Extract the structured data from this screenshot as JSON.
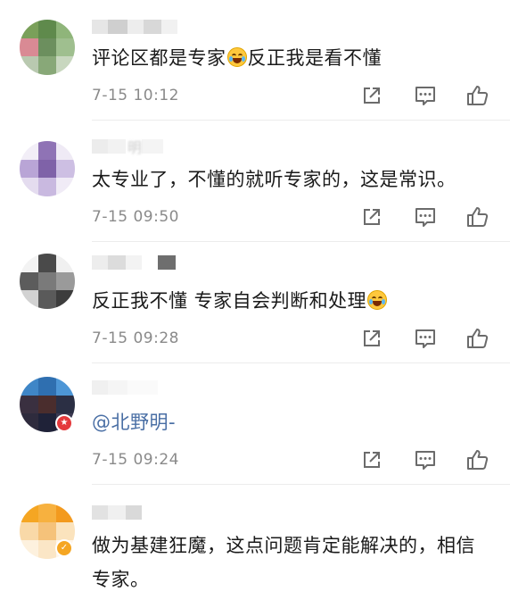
{
  "comments": [
    {
      "text_before": "评论区都是专家",
      "text_after": "反正我是看不懂",
      "time": "7-15 10:12"
    },
    {
      "username_visible": "明",
      "text": "太专业了，不懂的就听专家的，这是常识。",
      "time": "7-15 09:50"
    },
    {
      "text": "反正我不懂 专家自会判断和处理",
      "time": "7-15 09:28"
    },
    {
      "text": "@北野明-",
      "time": "7-15 09:24"
    },
    {
      "text": "做为基建狂魔，这点问题肯定能解决的，相信专家。"
    }
  ],
  "icons": {
    "forward": "forward-icon",
    "comment": "comment-icon",
    "like": "like-icon"
  },
  "colors": {
    "text": "#1a1a1a",
    "time": "#8a8a8a",
    "mention": "#4a6fa5",
    "icon": "#6b6b6b"
  }
}
